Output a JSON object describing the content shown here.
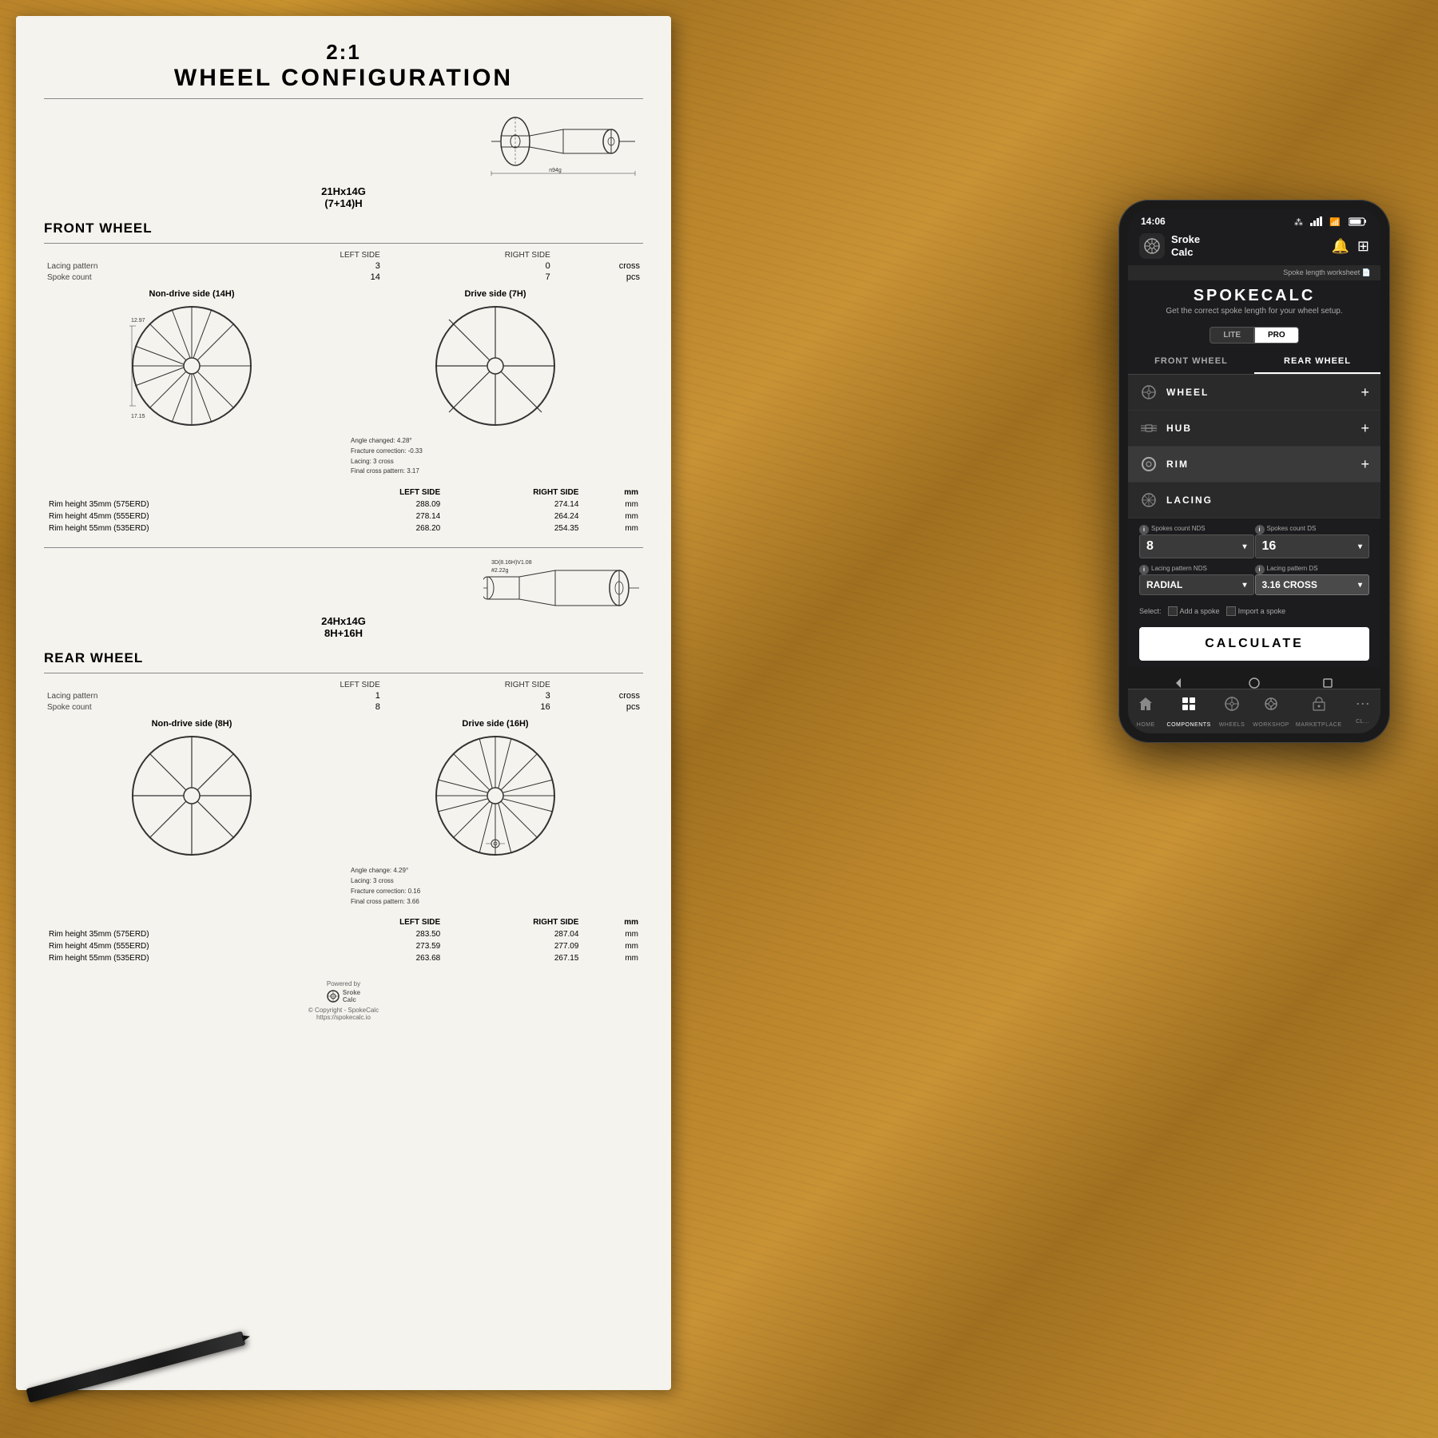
{
  "table": {
    "bg_color": "#b5832a"
  },
  "worksheet": {
    "title_ratio": "2:1",
    "title_config": "WHEEL CONFIGURATION",
    "front_wheel": {
      "title": "FRONT WHEEL",
      "left_side": "LEFT SIDE",
      "right_side": "RIGHT SIDE",
      "cross_label": "cross",
      "pcs_label": "pcs",
      "lacing_label": "Lacing pattern",
      "spoke_label": "Spoke count",
      "left_lacing": "3",
      "right_lacing": "0",
      "left_spokes": "14",
      "right_spokes": "7",
      "hub_label": "21Hx14G",
      "hub_sub": "(7+14)H",
      "nds_label": "Non-drive side (14H)",
      "ds_label": "Drive side (7H)",
      "annotation": "Angle changed: 4.28°\nFracture correction: -0.33\nLacing: 3 cross\nFinal cross pattern: 3.17",
      "spoke_lengths_header": [
        "LEFT SIDE",
        "RIGHT SIDE",
        "mm"
      ],
      "spoke_rows": [
        {
          "desc": "Rim height 35mm (575ERD)",
          "left": "288.09",
          "right": "274.14",
          "unit": "mm"
        },
        {
          "desc": "Rim height 45mm (555ERD)",
          "left": "278.14",
          "right": "264.24",
          "unit": "mm"
        },
        {
          "desc": "Rim height 55mm (535ERD)",
          "left": "268.20",
          "right": "254.35",
          "unit": "mm"
        }
      ]
    },
    "rear_wheel": {
      "title": "REAR WHEEL",
      "left_side": "LEFT SIDE",
      "right_side": "RIGHT SIDE",
      "cross_label": "cross",
      "pcs_label": "pcs",
      "lacing_label": "Lacing pattern",
      "spoke_label": "Spoke count",
      "left_lacing": "1",
      "right_lacing": "3",
      "left_spokes": "8",
      "right_spokes": "16",
      "hub_label": "24Hx14G",
      "hub_sub": "8H+16H",
      "nds_label": "Non-drive side (8H)",
      "ds_label": "Drive side (16H)",
      "annotation": "Angle change: 4.29°\nLacing: 3 cross\nFracture correction: 0.16\nFinal cross pattern: 3.66",
      "spoke_rows": [
        {
          "desc": "Rim height 35mm (575ERD)",
          "left": "283.50",
          "right": "287.04",
          "unit": "mm"
        },
        {
          "desc": "Rim height 45mm (555ERD)",
          "left": "273.59",
          "right": "277.09",
          "unit": "mm"
        },
        {
          "desc": "Rim height 55mm (535ERD)",
          "left": "263.68",
          "right": "267.15",
          "unit": "mm"
        }
      ]
    }
  },
  "phone": {
    "status": {
      "time": "14:06",
      "battery_icon": "🔋",
      "wifi_icon": "📶",
      "bt_icon": "🔷"
    },
    "app": {
      "logo_text_line1": "Sroke",
      "logo_text_line2": "Calc",
      "worksheet_link": "Spoke length worksheet 📄",
      "title": "SPOKECALC",
      "subtitle": "Get the correct spoke length for your wheel setup.",
      "mode_lite": "LITE",
      "mode_pro": "PRO",
      "tab_front": "FRONT WHEEL",
      "tab_rear": "REAR WHEEL",
      "sections": [
        {
          "name": "WHEEL",
          "icon": "⚙️"
        },
        {
          "name": "HUB",
          "icon": "🔧"
        },
        {
          "name": "RIM",
          "icon": "⭕"
        },
        {
          "name": "LACING",
          "icon": "✳️"
        }
      ],
      "spokes_nds_label": "Spokes count NDS",
      "spokes_ds_label": "Spokes count DS",
      "spokes_nds_value": "8",
      "spokes_ds_value": "16",
      "lacing_nds_label": "Lacing pattern NDS",
      "lacing_ds_label": "Lacing pattern DS",
      "lacing_nds_value": "RADIAL",
      "lacing_ds_value": "3.16 CROSS",
      "select_label": "Select:",
      "add_spoke_label": "Add a spoke",
      "import_spoke_label": "Import a spoke",
      "calculate_btn": "CALCULATE",
      "nav": [
        {
          "icon": "🏠",
          "label": "HOME"
        },
        {
          "icon": "⚙️",
          "label": "COMPONENTS"
        },
        {
          "icon": "🔄",
          "label": "WHEELS"
        },
        {
          "icon": "🔧",
          "label": "WORKSHOP"
        },
        {
          "icon": "🛒",
          "label": "MARKETPLACE"
        },
        {
          "icon": "⋯",
          "label": "CL..."
        }
      ]
    }
  }
}
